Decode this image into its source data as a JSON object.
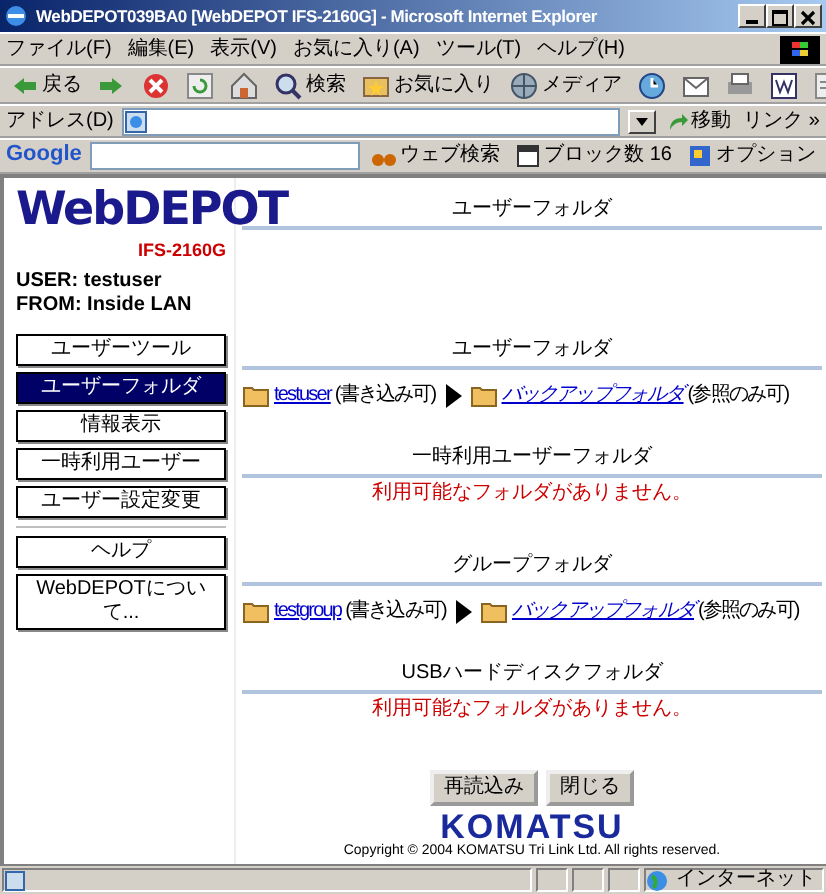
{
  "window": {
    "title": "WebDEPOT039BA0 [WebDEPOT IFS-2160G] - Microsoft Internet Explorer"
  },
  "menu": [
    "ファイル(F)",
    "編集(E)",
    "表示(V)",
    "お気に入り(A)",
    "ツール(T)",
    "ヘルプ(H)"
  ],
  "toolbar": [
    {
      "kind": "back",
      "label": "戻る"
    },
    {
      "kind": "forward"
    },
    {
      "kind": "stop"
    },
    {
      "kind": "refresh"
    },
    {
      "kind": "home"
    },
    {
      "kind": "search",
      "label": "検索"
    },
    {
      "kind": "favorites",
      "label": "お気に入り"
    },
    {
      "kind": "media",
      "label": "メディア"
    },
    {
      "kind": "history"
    },
    {
      "kind": "mail"
    },
    {
      "kind": "print"
    },
    {
      "kind": "word"
    },
    {
      "kind": "discuss"
    }
  ],
  "address": {
    "label": "アドレス(D)",
    "go": "移動",
    "links": "リンク »"
  },
  "google": {
    "logo": "Google",
    "search": "ウェブ検索",
    "blocked": "ブロック数 16",
    "options": "オプション"
  },
  "sidebar": {
    "logo": "WebDEPOT",
    "model": "IFS-2160G",
    "user": "USER: testuser",
    "from": "FROM: Inside LAN",
    "groups": [
      [
        {
          "label": "ユーザーツール",
          "selected": false
        },
        {
          "label": "ユーザーフォルダ",
          "selected": true
        },
        {
          "label": "情報表示",
          "selected": false
        },
        {
          "label": "一時利用ユーザー",
          "selected": false
        },
        {
          "label": "ユーザー設定変更",
          "selected": false
        }
      ],
      [
        {
          "label": "ヘルプ",
          "selected": false
        },
        {
          "label": "WebDEPOTについて...",
          "selected": false
        }
      ]
    ]
  },
  "main": {
    "title": "ユーザーフォルダ",
    "sections": [
      {
        "kind": "folders",
        "title": "ユーザーフォルダ",
        "folder": "testuser",
        "folder_note": "(書き込み可)",
        "backup": "バックアップフォルダ",
        "backup_note": "(参照のみ可)"
      },
      {
        "kind": "empty",
        "title": "一時利用ユーザーフォルダ",
        "message": "利用可能なフォルダがありません。"
      },
      {
        "kind": "folders",
        "title": "グループフォルダ",
        "folder": "testgroup",
        "folder_note": "(書き込み可)",
        "backup": "バックアップフォルダ",
        "backup_note": "(参照のみ可)"
      },
      {
        "kind": "empty",
        "title": "USBハードディスクフォルダ",
        "message": "利用可能なフォルダがありません。"
      }
    ],
    "buttons": [
      "再読込み",
      "閉じる"
    ],
    "footer_logo": "KOMATSU",
    "copyright": "Copyright © 2004 KOMATSU Tri Link Ltd. All rights reserved."
  },
  "status_bar": {
    "zone": "インターネット"
  }
}
